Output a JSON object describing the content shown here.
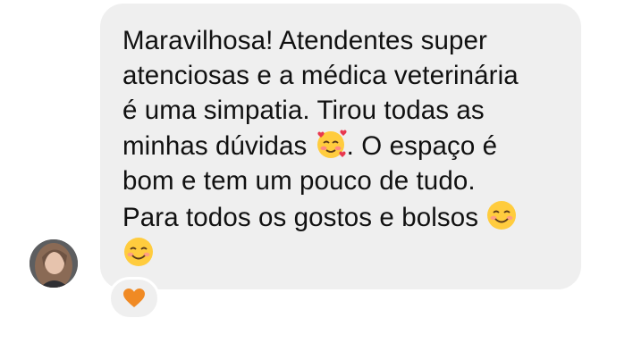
{
  "message": {
    "lines": [
      "Maravilhosa! Atendentes super",
      "atenciosas e a médica veterinária",
      "é uma simpatia.  Tirou todas as",
      "minhas dúvidas",
      ". O espaço é",
      "bom e tem um pouco de tudo.",
      "Para todos os gostos e bolsos"
    ],
    "emojis": [
      "smiling-face-with-hearts",
      "smiling-face",
      "smiling-face"
    ]
  },
  "reaction": {
    "emoji": "orange-heart",
    "color": "#F08A24"
  },
  "colors": {
    "bubble": "#EFEFEF",
    "text": "#111111",
    "background": "#FFFFFF"
  }
}
